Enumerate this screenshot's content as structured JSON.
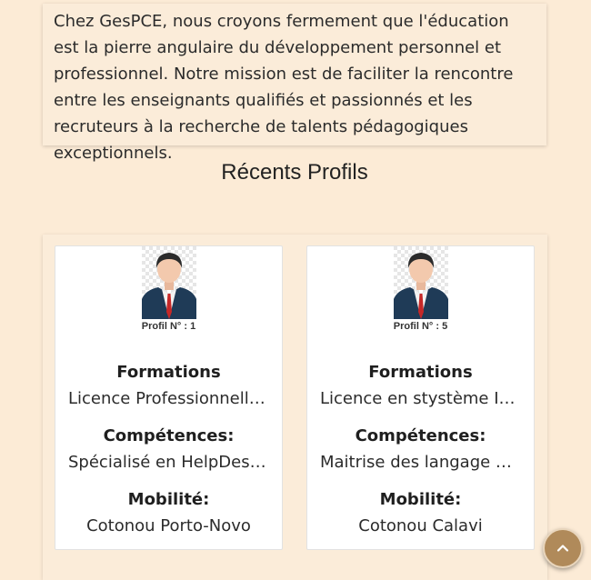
{
  "intro": {
    "text": "Chez GesPCE, nous croyons fermement que l'éducation est la pierre angulaire du développement personnel et professionnel. Notre mission est de faciliter la rencontre entre les enseignants qualifiés et passionnés et les recruteurs à la recherche de talents pédagogiques exceptionnels."
  },
  "section_title": "Récents Profils",
  "profiles": [
    {
      "profile_no": "Profil N° : 1",
      "formations_label": "Formations",
      "formations": "Licence Professionnelle en Informatique",
      "competences_label": "Compétences:",
      "competences": "Spécialisé en HelpDesk/Support",
      "mobilite_label": "Mobilité:",
      "mobilite": "Cotonou Porto-Novo"
    },
    {
      "profile_no": "Profil N° : 5",
      "formations_label": "Formations",
      "formations": "Licence en stystème Informatique",
      "competences_label": "Compétences:",
      "competences": "Maitrise des langage de programmation",
      "mobilite_label": "Mobilité:",
      "mobilite": "Cotonou Calavi"
    }
  ],
  "scroll_top_icon": "chevron-up-icon",
  "colors": {
    "background": "#fcebd6",
    "card": "#ffffff",
    "scroll_button": "#b08a5a"
  }
}
